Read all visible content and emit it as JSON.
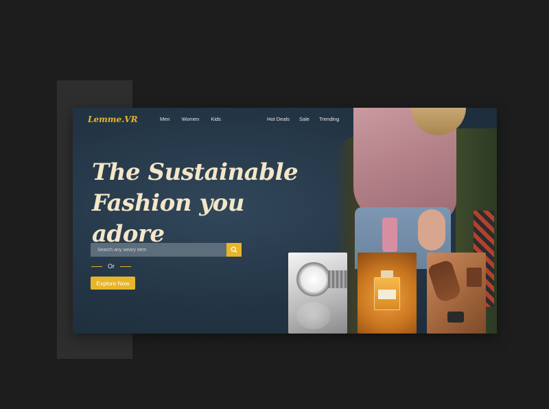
{
  "brand": {
    "logo": "Lemme.VR",
    "accent_color": "#e8b52a"
  },
  "nav": {
    "left": [
      "Men",
      "Women",
      "Kids"
    ],
    "right": [
      "Hot Deals",
      "Sale",
      "Trending"
    ]
  },
  "hero": {
    "headline_line1": "The Sustainable",
    "headline_line2": "Fashion you adore"
  },
  "search": {
    "placeholder": "Search any weary item",
    "icon": "search-icon"
  },
  "divider": {
    "or_text": "Or"
  },
  "cta": {
    "explore_label": "Explore Now"
  },
  "products": [
    {
      "name": "watch",
      "icon": "watch-image"
    },
    {
      "name": "perfume",
      "icon": "perfume-image"
    },
    {
      "name": "shoes-and-accessories",
      "icon": "shoes-image"
    }
  ]
}
